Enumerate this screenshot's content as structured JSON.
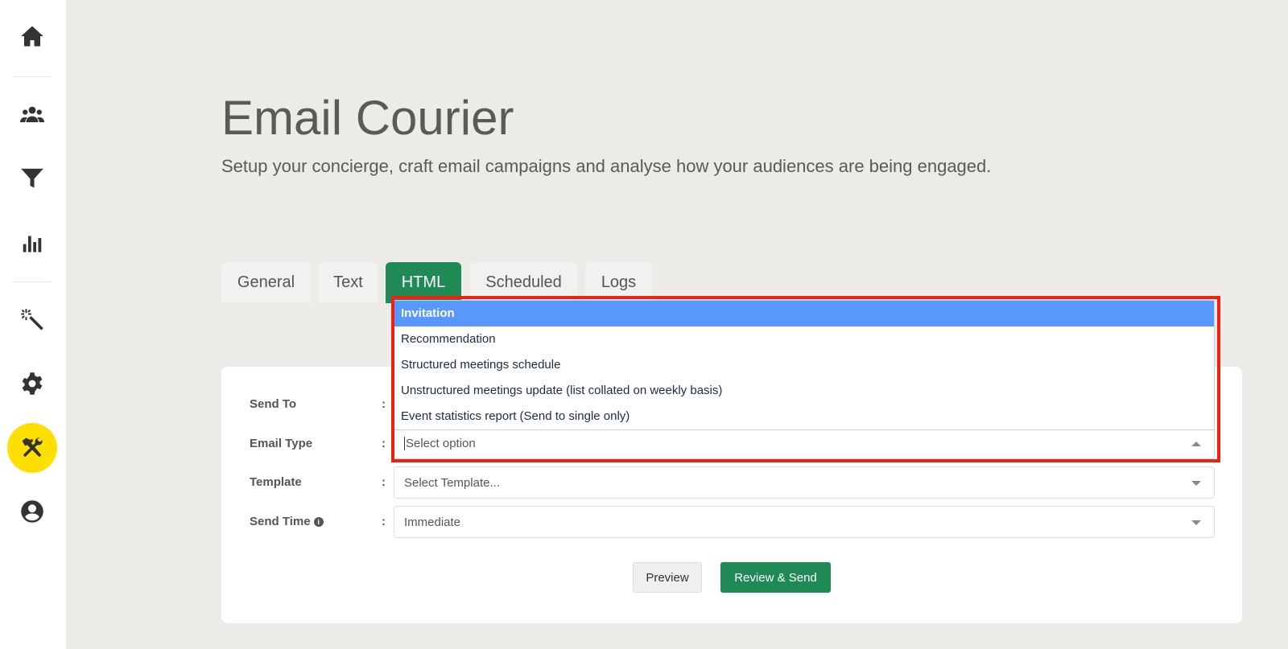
{
  "sidebar": {
    "items": [
      "home",
      "people",
      "filter",
      "analytics",
      "magic",
      "settings",
      "tools",
      "profile"
    ],
    "active": "tools",
    "active_color": "#ffdf00"
  },
  "header": {
    "title": "Email Courier",
    "subtitle": "Setup your concierge, craft email campaigns and analyse how your audiences are being engaged."
  },
  "tabs": [
    {
      "label": "General"
    },
    {
      "label": "Text"
    },
    {
      "label": "HTML",
      "active": true
    },
    {
      "label": "Scheduled"
    },
    {
      "label": "Logs"
    }
  ],
  "form": {
    "send_to": {
      "label": "Send To"
    },
    "email_type": {
      "label": "Email Type",
      "placeholder": "Select option",
      "options": [
        "Invitation",
        "Recommendation",
        "Structured meetings schedule",
        "Unstructured meetings update (list collated on weekly basis)",
        "Event statistics report (Send to single only)"
      ],
      "highlighted": "Invitation"
    },
    "template": {
      "label": "Template",
      "value": "Select Template..."
    },
    "send_time": {
      "label": "Send Time",
      "value": "Immediate",
      "info": "i"
    },
    "colon": ":"
  },
  "buttons": {
    "preview": "Preview",
    "review_send": "Review & Send"
  },
  "colors": {
    "accent": "#1f8a55",
    "highlight": "#5897fb",
    "annotation": "#f0200f"
  }
}
